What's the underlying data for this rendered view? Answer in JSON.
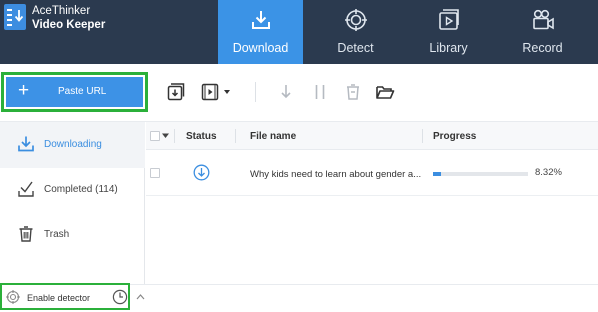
{
  "app": {
    "title_line1": "AceThinker",
    "title_line2": "Video Keeper"
  },
  "nav": {
    "tabs": [
      {
        "label": "Download",
        "icon": "download-tray-icon",
        "active": true
      },
      {
        "label": "Detect",
        "icon": "crosshair-icon",
        "active": false
      },
      {
        "label": "Library",
        "icon": "video-library-icon",
        "active": false
      },
      {
        "label": "Record",
        "icon": "video-camera-icon",
        "active": false
      }
    ]
  },
  "toolbar": {
    "paste_url_label": "Paste URL",
    "buttons": [
      "copy-download-icon",
      "video-format-icon",
      "resume-icon",
      "pause-icon",
      "delete-icon",
      "open-folder-icon"
    ]
  },
  "sidebar": {
    "items": [
      {
        "label": "Downloading",
        "icon": "download-icon",
        "active": true
      },
      {
        "label": "Completed (114)",
        "icon": "check-icon",
        "active": false
      },
      {
        "label": "Trash",
        "icon": "trash-icon",
        "active": false
      }
    ]
  },
  "table": {
    "headers": {
      "status": "Status",
      "file_name": "File name",
      "progress": "Progress"
    },
    "rows": [
      {
        "file_name": "Why kids need to learn about gender a...",
        "progress_fraction": 0.0832,
        "progress_text": "8.32%"
      }
    ]
  },
  "footer": {
    "enable_detector_label": "Enable detector"
  },
  "colors": {
    "header_bg": "#2b3a4f",
    "accent": "#3b93e6",
    "highlight_outline": "#2bb03a"
  }
}
